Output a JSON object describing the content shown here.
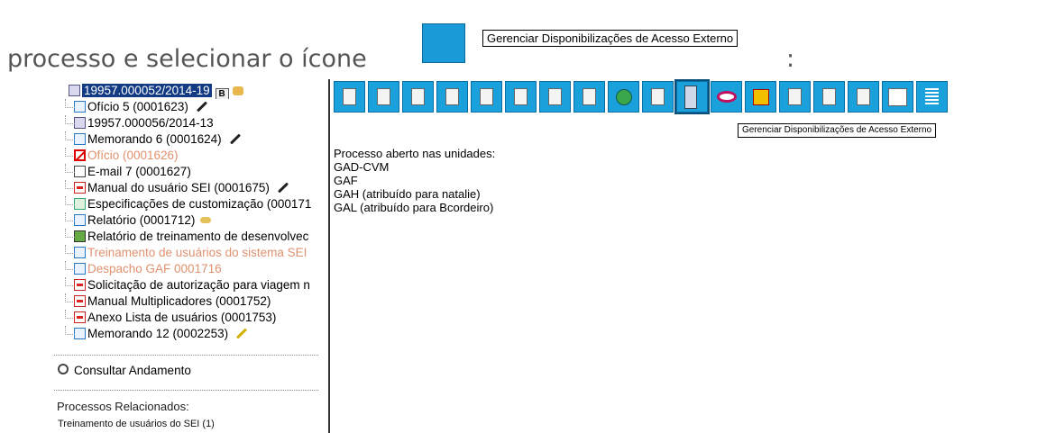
{
  "header": {
    "instruction": "processo e selecionar o ícone",
    "tooltip": "Gerenciar Disponibilizações de Acesso Externo",
    "colon": ":"
  },
  "tree": {
    "root": {
      "label": "19957.000052/2014-19",
      "badge": "B"
    },
    "items": [
      {
        "label": "Ofício 5 (0001623)",
        "icon": "document-icon",
        "mark": "pen"
      },
      {
        "label": "19957.000056/2014-13",
        "icon": "linked-process-icon",
        "mark": ""
      },
      {
        "label": "Memorando 6 (0001624)",
        "icon": "document-icon",
        "mark": "pen"
      },
      {
        "label": "Ofício (0001626)",
        "icon": "cancelled-icon",
        "mark": "",
        "muted": true
      },
      {
        "label": "E-mail 7 (0001627)",
        "icon": "email-icon",
        "mark": ""
      },
      {
        "label": "Manual do usuário SEI (0001675)",
        "icon": "pdf-icon",
        "mark": "pen"
      },
      {
        "label": "Especificações de customização (000171",
        "icon": "spreadsheet-icon",
        "mark": ""
      },
      {
        "label": "Relatório (0001712)",
        "icon": "document-icon",
        "mark": "key"
      },
      {
        "label": "Relatório de treinamento de desenvolvec",
        "icon": "zip-icon",
        "mark": ""
      },
      {
        "label": "Treinamento de usuários do sistema SEI",
        "icon": "document-icon",
        "mark": "",
        "muted": true
      },
      {
        "label": "Despacho GAF 0001716",
        "icon": "document-icon",
        "mark": "",
        "muted": true
      },
      {
        "label": "Solicitação de autorização para viagem n",
        "icon": "pdf-icon",
        "mark": ""
      },
      {
        "label": "Manual Multiplicadores (0001752)",
        "icon": "pdf-icon",
        "mark": ""
      },
      {
        "label": "Anexo Lista de usuários (0001753)",
        "icon": "pdf-icon",
        "mark": ""
      },
      {
        "label": "Memorando 12 (0002253)",
        "icon": "document-icon",
        "mark": "pen-yellow"
      }
    ]
  },
  "sidebar": {
    "consultar_label": "Consultar Andamento",
    "related_title": "Processos Relacionados:",
    "related_items": [
      "Treinamento de usuários do SEI (1)"
    ]
  },
  "toolbar": {
    "buttons": [
      "new-document-icon",
      "send-document-icon",
      "send-process-icon",
      "approve-icon",
      "assign-user-icon",
      "assign-multiple-icon",
      "move-document-icon",
      "send-email-icon",
      "refresh-icon",
      "library-icon",
      "external-access-icon",
      "monitor-icon",
      "suspend-icon",
      "edit-document-icon",
      "remove-document-icon",
      "annotation-icon",
      "generate-pdf-icon",
      "list-icon"
    ],
    "selected_index": 10,
    "tooltip": "Gerenciar Disponibilizações de Acesso Externo"
  },
  "main": {
    "units_title": "Processo aberto nas unidades:",
    "units": [
      "GAD-CVM",
      "GAF",
      "GAH (atribuído para natalie)",
      "GAL (atribuído para Bcordeiro)"
    ]
  }
}
